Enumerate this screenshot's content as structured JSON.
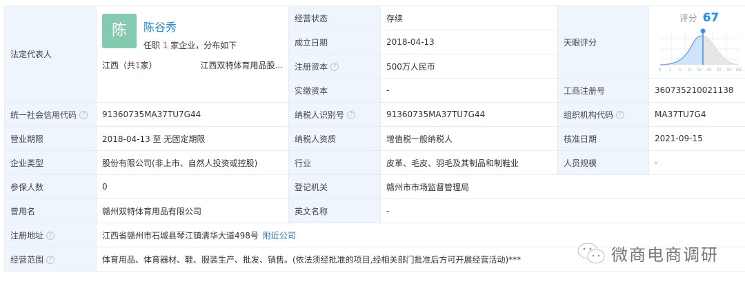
{
  "legal_rep": {
    "label": "法定代表人",
    "avatar_char": "陈",
    "name": "陈谷秀",
    "jobs_prefix": "任职 ",
    "jobs_count": "1",
    "jobs_suffix": " 家企业，分布如下",
    "region_prefix": "江西（共",
    "region_count": "1",
    "region_suffix": "家）",
    "company": "江西双特体育用品股..."
  },
  "top_rows": [
    {
      "label": "经营状态",
      "value": "存续"
    },
    {
      "label": "成立日期",
      "value": "2018-04-13"
    },
    {
      "label": "注册资本",
      "value": "500万人民币",
      "help": true
    },
    {
      "label": "实缴资本",
      "value": "-"
    }
  ],
  "score": {
    "label": "天眼评分",
    "title": "评分",
    "value": "67",
    "ticks": [
      "0",
      "1",
      "3",
      "15",
      "50",
      "85",
      "97",
      "99",
      "100"
    ],
    "accent": "#1a8cff"
  },
  "reg_no": {
    "label": "工商注册号",
    "value": "360735210021138"
  },
  "rows": [
    [
      {
        "label": "统一社会信用代码",
        "help": true,
        "value": "91360735MA37TU7G44"
      },
      {
        "label": "纳税人识别号",
        "help": true,
        "value": "91360735MA37TU7G44"
      },
      {
        "label": "组织机构代码",
        "help": true,
        "value": "MA37TU7G4"
      }
    ],
    [
      {
        "label": "营业期限",
        "value": "2018-04-13  至 无固定期限"
      },
      {
        "label": "纳税人资质",
        "value": "增值税一般纳税人"
      },
      {
        "label": "核准日期",
        "value": "2021-09-15"
      }
    ],
    [
      {
        "label": "企业类型",
        "value": "股份有限公司(非上市、自然人投资或控股)"
      },
      {
        "label": "行业",
        "value": "皮革、毛皮、羽毛及其制品和制鞋业"
      },
      {
        "label": "人员规模",
        "value": "-"
      }
    ],
    [
      {
        "label": "参保人数",
        "value": "0"
      },
      {
        "label": "登记机关",
        "value": "赣州市市场监督管理局"
      }
    ],
    [
      {
        "label": "曾用名",
        "value": "赣州双特体育用品有限公司"
      },
      {
        "label": "英文名称",
        "value": "-"
      }
    ]
  ],
  "address": {
    "label": "注册地址",
    "value": "江西省赣州市石城县琴江镇清华大道498号",
    "link": "附近公司"
  },
  "scope": {
    "label": "经营范围",
    "value": "体育用品、体育器材、鞋、服装生产、批发、销售。(依法须经批准的项目,经相关部门批准后方可开展经营活动)***"
  },
  "watermark": "微商电商调研"
}
